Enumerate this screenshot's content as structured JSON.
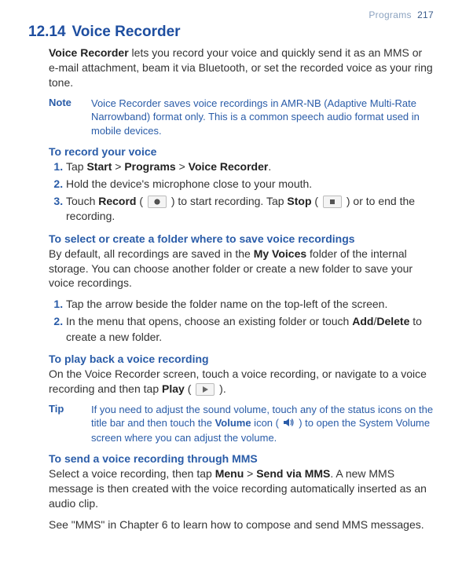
{
  "header": {
    "section": "Programs",
    "page": "217"
  },
  "title": {
    "num": "12.14",
    "text": "Voice Recorder"
  },
  "intro": {
    "app_name": "Voice Recorder",
    "rest": " lets you record your voice and quickly send it as an MMS or e-mail attachment, beam it via Bluetooth, or set the recorded voice as your ring tone."
  },
  "note": {
    "label": "Note",
    "text": "Voice Recorder saves voice recordings in AMR-NB (Adaptive Multi-Rate Narrowband) format only. This is a common speech audio format used in mobile devices."
  },
  "record": {
    "heading": "To record your voice",
    "step1": {
      "pre": "Tap ",
      "start": "Start",
      "sep1": " > ",
      "programs": "Programs",
      "sep2": " > ",
      "app": "Voice Recorder",
      "post": "."
    },
    "step2": "Hold the device's microphone close to your mouth.",
    "step3": {
      "pre": "Touch ",
      "record": "Record",
      "mid1": " ( ",
      "mid2": " ) to start recording. Tap ",
      "stop": "Stop",
      "mid3": " ( ",
      "mid4": " ) or  to end the recording."
    }
  },
  "folder": {
    "heading": "To select or create a folder where to save voice recordings",
    "para": {
      "pre": "By default, all recordings are saved in the ",
      "myvoices": "My Voices",
      "post": " folder of the internal storage. You can choose another folder or create a new folder to save your voice recordings."
    },
    "step1": "Tap the arrow beside the folder name on the top-left of the screen.",
    "step2": {
      "pre": "In the menu that opens, choose an existing folder or touch ",
      "add": "Add",
      "slash": "/",
      "delete": "Delete",
      "post": " to create a new folder."
    }
  },
  "play": {
    "heading": "To play back a voice recording",
    "para": {
      "pre": "On the Voice Recorder screen, touch a voice recording, or navigate to a voice recording and then tap ",
      "play": "Play",
      "mid1": " ( ",
      "mid2": " )."
    }
  },
  "tip": {
    "label": "Tip",
    "pre": "If you need to adjust the sound volume, touch any of the status icons on the title bar and then touch the ",
    "volume": "Volume",
    "mid1": " icon ( ",
    "mid2": " ) to open the System Volume screen where you can adjust the volume."
  },
  "mms": {
    "heading": "To send a voice recording through MMS",
    "para": {
      "pre": "Select a voice recording, then tap ",
      "menu": "Menu",
      "sep": " > ",
      "send": "Send via MMS",
      "post": ". A new MMS message is then created with the voice recording automatically inserted as an audio clip."
    },
    "see": "See \"MMS\" in Chapter 6 to learn how to compose and send MMS messages."
  }
}
